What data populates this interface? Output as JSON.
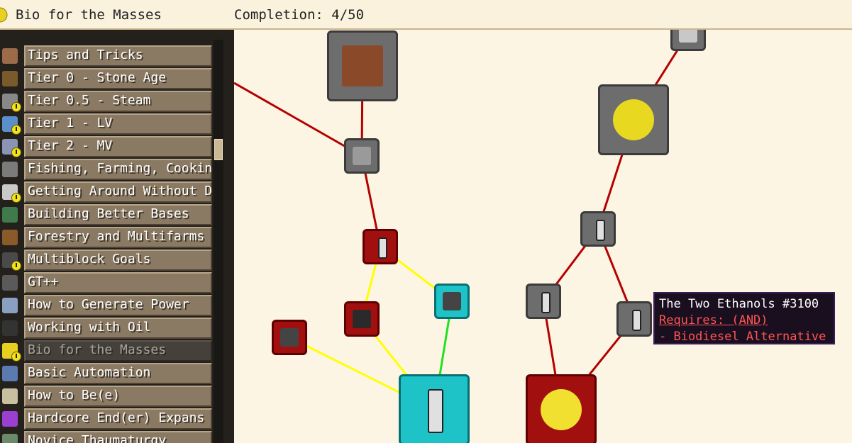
{
  "header": {
    "title": "Bio for the Masses",
    "completion": "Completion: 4/50"
  },
  "sidebar": {
    "items": [
      {
        "label": "Tips and Tricks",
        "icon": "scroll-icon",
        "warn": false,
        "active": false,
        "color": "#9b6b4a"
      },
      {
        "label": "Tier 0 - Stone Age",
        "icon": "pickaxe-icon",
        "warn": false,
        "active": false,
        "color": "#7a5a2a"
      },
      {
        "label": "Tier 0.5 - Steam",
        "icon": "steam-icon",
        "warn": true,
        "active": false,
        "color": "#888888"
      },
      {
        "label": "Tier 1 - LV",
        "icon": "lv-machine-icon",
        "warn": true,
        "active": false,
        "color": "#5a8fc9"
      },
      {
        "label": "Tier 2 - MV",
        "icon": "mv-machine-icon",
        "warn": true,
        "active": false,
        "color": "#8a95b5"
      },
      {
        "label": "Fishing, Farming, Cooking",
        "icon": "fishing-icon",
        "warn": false,
        "active": false,
        "color": "#7b7b7b"
      },
      {
        "label": "Getting Around Without Dyi",
        "icon": "boots-icon",
        "warn": true,
        "active": false,
        "color": "#c9c9c9"
      },
      {
        "label": "Building Better Bases",
        "icon": "bookshelf-icon",
        "warn": false,
        "active": false,
        "color": "#3f7a4a"
      },
      {
        "label": "Forestry and Multifarms",
        "icon": "forestry-chest-icon",
        "warn": false,
        "active": false,
        "color": "#8a5a2b"
      },
      {
        "label": "Multiblock Goals",
        "icon": "multiblock-icon",
        "warn": true,
        "active": false,
        "color": "#4a4a4a"
      },
      {
        "label": "GT++",
        "icon": "gtpp-machine-icon",
        "warn": false,
        "active": false,
        "color": "#5a5a5a"
      },
      {
        "label": "How to Generate Power",
        "icon": "lightning-gear-icon",
        "warn": false,
        "active": false,
        "color": "#8aa0c0"
      },
      {
        "label": "Working with Oil",
        "icon": "oil-bucket-icon",
        "warn": false,
        "active": false,
        "color": "#333333"
      },
      {
        "label": "Bio for the Masses",
        "icon": "bio-flower-icon",
        "warn": true,
        "active": true,
        "color": "#e8d020"
      },
      {
        "label": "Basic Automation",
        "icon": "conveyor-icon",
        "warn": false,
        "active": false,
        "color": "#5a7ab0"
      },
      {
        "label": "How to Be(e)",
        "icon": "beehive-icon",
        "warn": false,
        "active": false,
        "color": "#c9c0a0"
      },
      {
        "label": "Hardcore End(er) Expans",
        "icon": "ender-crystal-icon",
        "warn": false,
        "active": false,
        "color": "#9b3fd0"
      },
      {
        "label": "Novice Thaumaturgy",
        "icon": "thaumcraft-icon",
        "warn": false,
        "active": false,
        "color": "#6a8a6a"
      }
    ]
  },
  "quest_map": {
    "nodes": [
      {
        "id": "bio-machine-big",
        "style": "gray",
        "icon": "brown-machine-icon"
      },
      {
        "id": "top-right-small",
        "style": "gray",
        "icon": "pipe-icon"
      },
      {
        "id": "pufferfish",
        "style": "gray",
        "icon": "pufferfish-icon"
      },
      {
        "id": "casing-small",
        "style": "gray",
        "icon": "casing-icon"
      },
      {
        "id": "cell-orange-top",
        "style": "gray",
        "icon": "cell-icon"
      },
      {
        "id": "cell-red",
        "style": "red",
        "icon": "cell-icon"
      },
      {
        "id": "cyan-machine",
        "style": "cyan",
        "icon": "machine-icon"
      },
      {
        "id": "dark-block",
        "style": "red",
        "icon": "dark-block-icon"
      },
      {
        "id": "red-machine-left",
        "style": "red",
        "icon": "machine-icon"
      },
      {
        "id": "cell-left",
        "style": "gray",
        "icon": "cell-icon"
      },
      {
        "id": "cell-right",
        "style": "gray",
        "icon": "cell-icon"
      },
      {
        "id": "cell-big-cyan",
        "style": "cyan",
        "icon": "cell-icon"
      },
      {
        "id": "bio-flower-big",
        "style": "red",
        "icon": "bio-flower-icon"
      }
    ],
    "edges": [
      {
        "from": "bio-machine-big",
        "to": "casing-small",
        "color": "#b40000"
      },
      {
        "from": "casing-small",
        "to": "cell-red",
        "color": "#b40000"
      },
      {
        "from": "cell-red",
        "to": "cyan-machine",
        "color": "#ffff00"
      },
      {
        "from": "cell-red",
        "to": "dark-block",
        "color": "#ffff00"
      },
      {
        "from": "dark-block",
        "to": "cell-big-cyan",
        "color": "#ffff00"
      },
      {
        "from": "red-machine-left",
        "to": "cell-big-cyan",
        "color": "#ffff00"
      },
      {
        "from": "cyan-machine",
        "to": "cell-big-cyan",
        "color": "#22e022"
      },
      {
        "from": "pufferfish",
        "to": "top-right-small",
        "color": "#b40000"
      },
      {
        "from": "pufferfish",
        "to": "cell-orange-top",
        "color": "#b40000"
      },
      {
        "from": "cell-orange-top",
        "to": "cell-left",
        "color": "#b40000"
      },
      {
        "from": "cell-orange-top",
        "to": "cell-right",
        "color": "#b40000"
      },
      {
        "from": "cell-left",
        "to": "bio-flower-big",
        "color": "#b40000"
      },
      {
        "from": "cell-right",
        "to": "bio-flower-big",
        "color": "#b40000"
      }
    ]
  },
  "tooltip": {
    "title": "The Two Ethanols #3100",
    "requires": "Requires: (AND)",
    "requirement": "- Biodiesel Alternative"
  }
}
